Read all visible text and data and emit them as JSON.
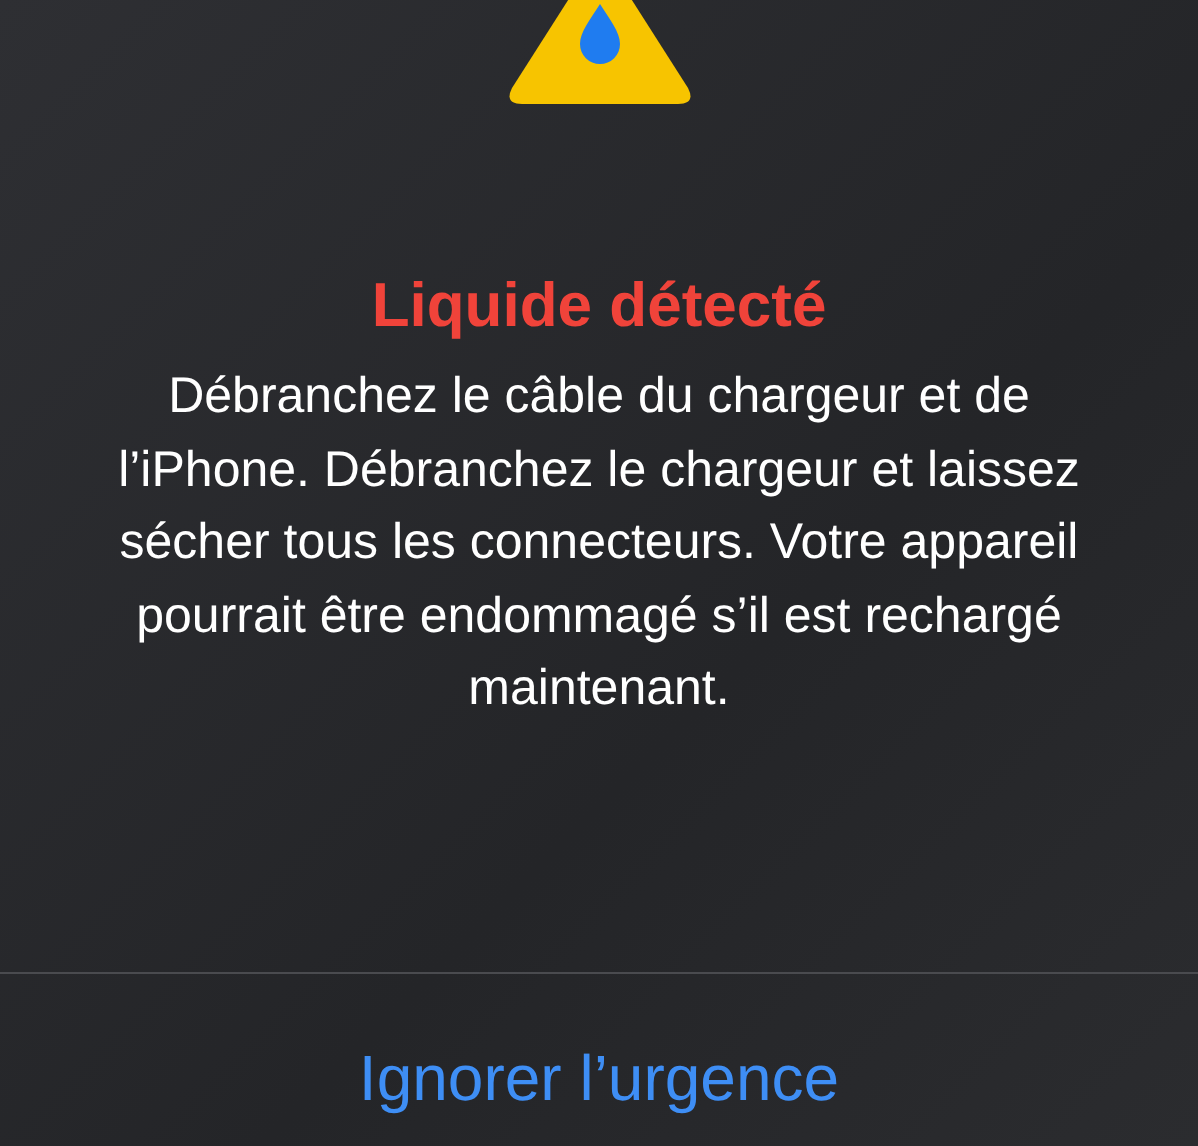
{
  "alert": {
    "title": "Liquide détecté",
    "message": "Débranchez le câble du chargeur et de l’iPhone. Débranchez le chargeur et laissez sécher tous les connecteurs. Votre appareil pourrait être endommagé s’il est rechargé maintenant.",
    "buttons": [
      "Ignorer l’urgence"
    ]
  }
}
